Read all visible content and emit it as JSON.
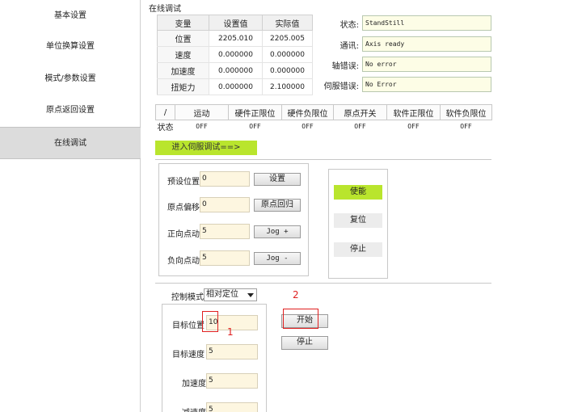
{
  "sidebar": {
    "items": [
      {
        "label": "基本设置"
      },
      {
        "label": "单位换算设置"
      },
      {
        "label": "模式/参数设置"
      },
      {
        "label": "原点返回设置"
      },
      {
        "label": "在线调试",
        "active": true
      }
    ]
  },
  "main": {
    "title": "在线调试",
    "values_table": {
      "headers": [
        "变量",
        "设置值",
        "实际值"
      ],
      "rows": [
        {
          "name": "位置",
          "set": "2205.010",
          "actual": "2205.005"
        },
        {
          "name": "速度",
          "set": "0.000000",
          "actual": "0.000000"
        },
        {
          "name": "加速度",
          "set": "0.000000",
          "actual": "0.000000"
        },
        {
          "name": "扭矩力",
          "set": "0.000000",
          "actual": "2.100000"
        }
      ]
    },
    "status": [
      {
        "label": "状态:",
        "value": "StandStill"
      },
      {
        "label": "通讯:",
        "value": "Axis ready"
      },
      {
        "label": "轴错误:",
        "value": "No error"
      },
      {
        "label": "伺服错误:",
        "value": "No Error"
      }
    ],
    "io_table": {
      "headers": [
        "/",
        "运动",
        "硬件正限位",
        "硬件负限位",
        "原点开关",
        "软件正限位",
        "软件负限位"
      ],
      "row_label": "状态",
      "values": [
        "OFF",
        "OFF",
        "OFF",
        "OFF",
        "OFF",
        "OFF"
      ]
    },
    "servo_button": "进入伺服调试==>",
    "jog_panel": {
      "preset": {
        "label": "预设位置",
        "value": "0",
        "button": "设置"
      },
      "origin_offset": {
        "label": "原点偏移",
        "value": "0",
        "button": "原点回归"
      },
      "jog_forward": {
        "label": "正向点动",
        "value": "5",
        "button": "Jog +"
      },
      "jog_reverse": {
        "label": "负向点动",
        "value": "5",
        "button": "Jog -"
      }
    },
    "control_panel": {
      "enable": "使能",
      "reset": "复位",
      "stop": "停止"
    },
    "motion": {
      "mode_label": "控制模式",
      "mode_value": "相对定位",
      "target_pos_label": "目标位置",
      "target_pos_value": "10",
      "target_speed_label": "目标速度",
      "target_speed_value": "5",
      "accel_label": "加速度",
      "accel_value": "5",
      "decel_label": "减速度",
      "decel_value": "5",
      "start_button": "开始",
      "stop_button": "停止"
    },
    "annotations": {
      "one": "1",
      "two": "2",
      "color": "#e02020"
    }
  },
  "colors": {
    "accent_green": "#b9e52d",
    "input_bg": "#fdf6e0",
    "active_nav": "#dcdcdc"
  }
}
